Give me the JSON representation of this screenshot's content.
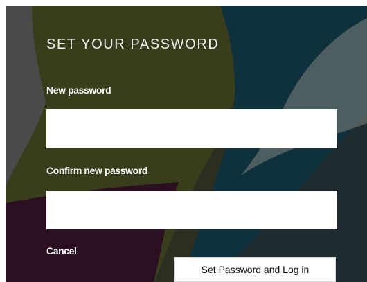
{
  "form": {
    "title": "SET YOUR PASSWORD",
    "new_password_label": "New password",
    "new_password_value": "",
    "confirm_password_label": "Confirm new password",
    "confirm_password_value": "",
    "cancel_label": "Cancel",
    "submit_label": "Set Password and Log in"
  },
  "theme": {
    "background_dark": "#2b2f21",
    "olive": "#3a3d1c",
    "teal": "#0e313b",
    "plum": "#2a1021",
    "gray_left": "#4a4a4a"
  }
}
